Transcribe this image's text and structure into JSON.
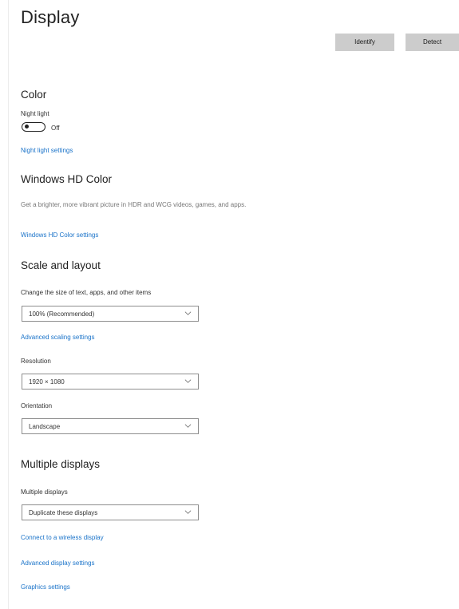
{
  "page": {
    "title": "Display"
  },
  "toolbar": {
    "identify_label": "Identify",
    "detect_label": "Detect"
  },
  "color_section": {
    "heading": "Color",
    "night_light_label": "Night light",
    "night_light_state": "Off",
    "night_light_on": false,
    "night_light_settings_link": "Night light settings"
  },
  "hd_color_section": {
    "heading": "Windows HD Color",
    "description": "Get a brighter, more vibrant picture in HDR and WCG videos, games, and apps.",
    "settings_link": "Windows HD Color settings"
  },
  "scale_section": {
    "heading": "Scale and layout",
    "scale_label": "Change the size of text, apps, and other items",
    "scale_value": "100% (Recommended)",
    "advanced_scaling_link": "Advanced scaling settings",
    "resolution_label": "Resolution",
    "resolution_value": "1920 × 1080",
    "orientation_label": "Orientation",
    "orientation_value": "Landscape"
  },
  "multiple_section": {
    "heading": "Multiple displays",
    "multiple_label": "Multiple displays",
    "multiple_value": "Duplicate these displays",
    "wireless_link": "Connect to a wireless display",
    "advanced_display_link": "Advanced display settings",
    "graphics_link": "Graphics settings"
  },
  "colors": {
    "link": "#1a73c9",
    "button_bg": "#cccccc",
    "select_border": "#8e8e8e"
  },
  "icons": {
    "dropdown": "chevron-down-icon"
  }
}
